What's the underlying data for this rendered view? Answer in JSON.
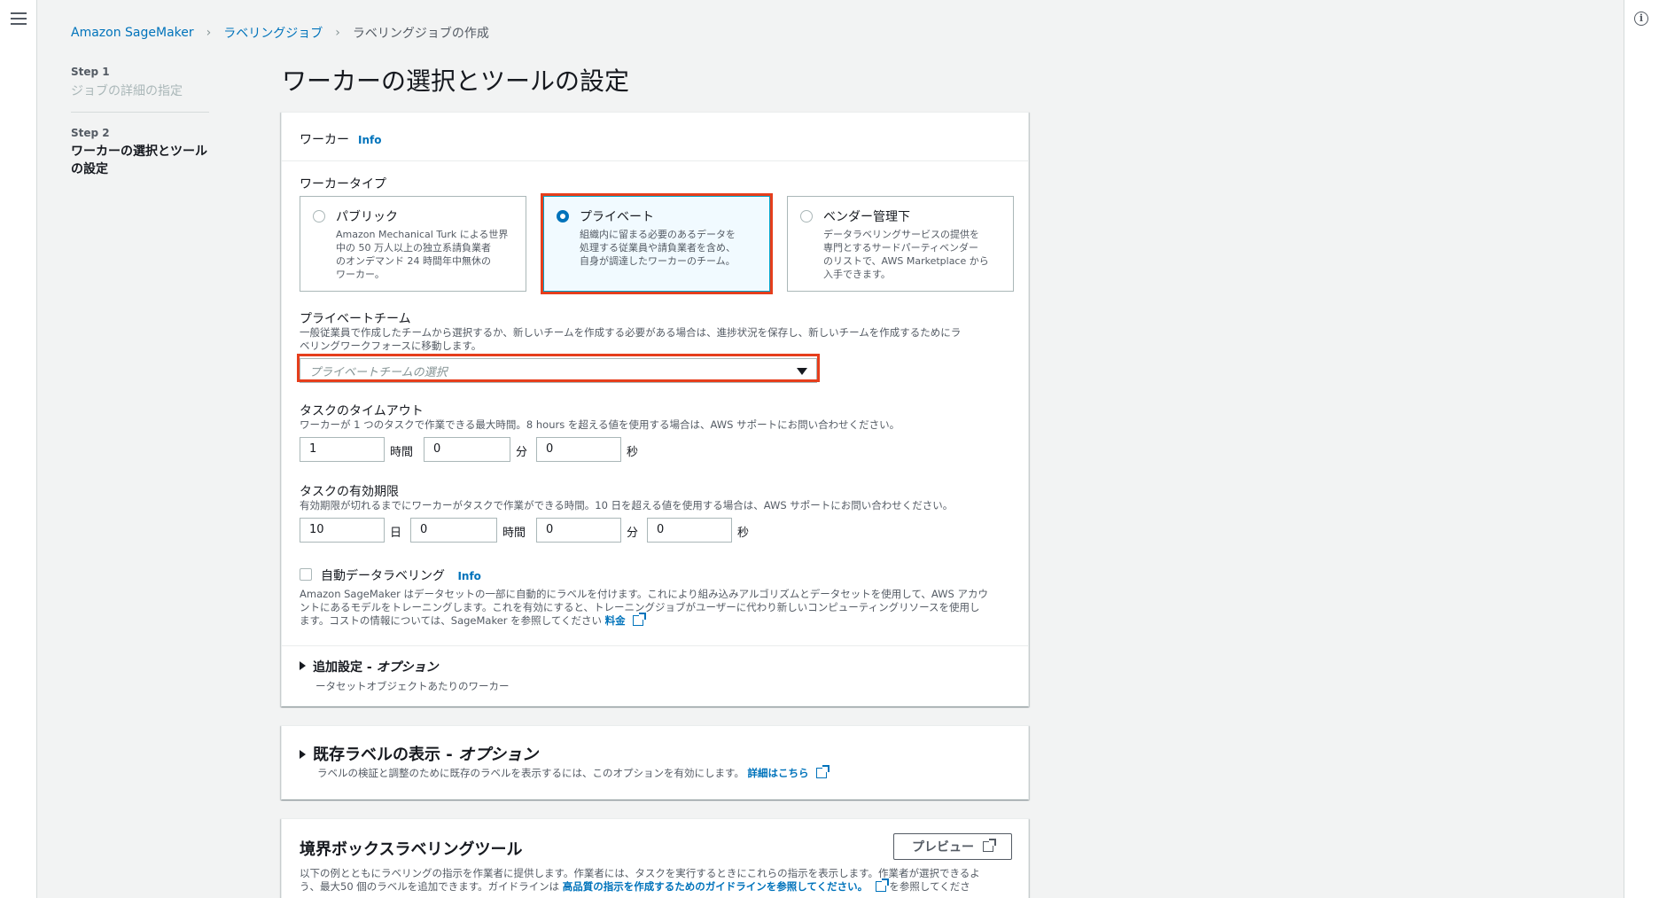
{
  "breadcrumb": {
    "item1": "Amazon SageMaker",
    "item2": "ラベリングジョブ",
    "item3": "ラベリングジョブの作成"
  },
  "steps": {
    "step1_num": "Step 1",
    "step1_title": "ジョブの詳細の指定",
    "step2_num": "Step 2",
    "step2_title_line1": "ワーカーの選択とツール",
    "step2_title_line2": "の設定"
  },
  "page_title": "ワーカーの選択とツールの設定",
  "worker_panel": {
    "header": "ワーカー",
    "info": "Info",
    "worker_type_label": "ワーカータイプ",
    "options": [
      {
        "title": "パブリック",
        "desc": [
          "Amazon Mechanical Turk による世界",
          "中の 50 万人以上の独立系請負業者",
          "のオンデマンド 24 時間年中無休の",
          "ワーカー。"
        ],
        "selected": false
      },
      {
        "title": "プライベート",
        "desc": [
          "組織内に留まる必要のあるデータを",
          "処理する従業員や請負業者を含め、",
          "自身が調達したワーカーのチーム。"
        ],
        "selected": true
      },
      {
        "title": "ベンダー管理下",
        "desc": [
          "データラベリングサービスの提供を",
          "専門とするサードパーティベンダー",
          "のリストで、AWS Marketplace から",
          "入手できます。"
        ],
        "selected": false
      }
    ],
    "private_team_label": "プライベートチーム",
    "private_team_desc_line1": "一般従業員で作成したチームから選択するか、新しいチームを作成する必要がある場合は、進捗状況を保存し、新しいチームを作成するためにラ",
    "private_team_desc_line2": "ベリングワークフォースに移動します。",
    "private_team_placeholder": "プライベートチームの選択",
    "timeout_label": "タスクのタイムアウト",
    "timeout_desc": "ワーカーが 1 つのタスクで作業できる最大時間。8 hours を超える値を使用する場合は、AWS サポートにお問い合わせください。",
    "timeout_hours": "1",
    "timeout_minutes": "0",
    "timeout_seconds": "0",
    "unit_hours": "時間",
    "unit_minutes": "分",
    "unit_seconds": "秒",
    "unit_days": "日",
    "expiry_label": "タスクの有効期限",
    "expiry_desc": "有効期限が切れるまでにワーカーがタスクで作業ができる時間。10 日を超える値を使用する場合は、AWS サポートにお問い合わせください。",
    "expiry_days": "10",
    "expiry_hours": "0",
    "expiry_minutes": "0",
    "expiry_seconds": "0",
    "auto_label": "自動データラベリング",
    "auto_desc_line1": "Amazon SageMaker はデータセットの一部に自動的にラベルを付けます。これにより組み込みアルゴリズムとデータセットを使用して、AWS アカウ",
    "auto_desc_line2": "ントにあるモデルをトレーニングします。これを有効にすると、トレーニングジョブがユーザーに代わり新しいコンピューティングリソースを使用し",
    "auto_desc_line3": "ます。コストの情報については、SageMaker を参照してください",
    "pricing_link": "料金",
    "additional_title": "追加設定 - ",
    "additional_title_em": "オプション",
    "additional_desc": "ータセットオブジェクトあたりのワーカー"
  },
  "existing_panel": {
    "title": "既存ラベルの表示 - ",
    "title_em": "オプション",
    "desc": "ラベルの検証と調整のために既存のラベルを表示するには、このオプションを有効にします。",
    "link": "詳細はこちら"
  },
  "tool_panel": {
    "title": "境界ボックスラベリングツール",
    "preview_button": "プレビュー",
    "desc_line1": "以下の例とともにラベリングの指示を作業者に提供します。作業者には、タスクを実行するときにこれらの指示を表示します。作業者が選択できるよ",
    "desc_line2_pre": "う、最大50 個のラベルを追加できます。ガイドラインは",
    "desc_line2_link": "高品質の指示を作成するためのガイドラインを参照してください。",
    "desc_line2_post": "を参照してくださ"
  },
  "colors": {
    "accent": "#0073bb",
    "highlight": "#e63e1c",
    "selected_bg": "#f1faff"
  }
}
